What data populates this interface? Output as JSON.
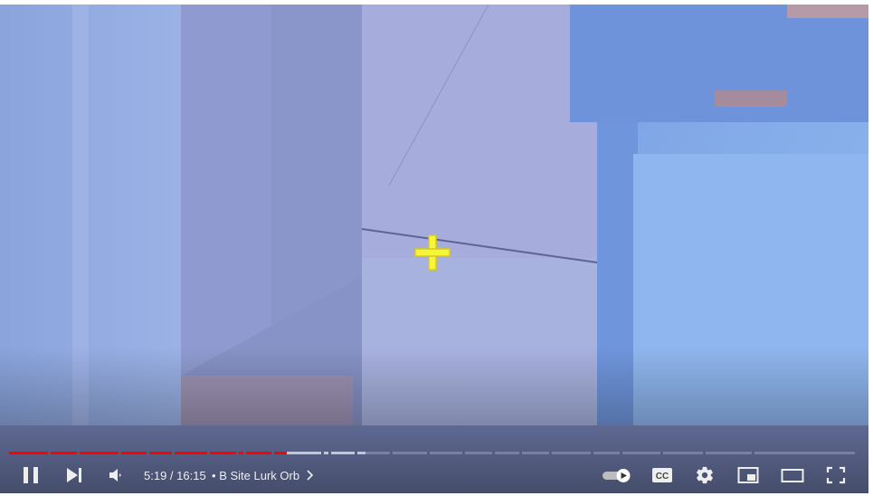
{
  "player": {
    "time": {
      "current": "5:19",
      "separator": " / ",
      "duration": "16:15"
    },
    "chapter": {
      "dot": "•",
      "title": "B Site Lurk Orb",
      "chevron_icon": "chevron-right-icon"
    },
    "progress": {
      "played_fraction": 0.327,
      "buffered_fraction": 0.42,
      "played_color": "#ff0000",
      "chapter_count": 23
    },
    "buttons": {
      "play_pause": {
        "icon": "pause-icon",
        "state": "playing"
      },
      "next": {
        "icon": "next-icon"
      },
      "volume": {
        "icon": "volume-muted-icon"
      },
      "autoplay": {
        "icon": "autoplay-toggle-icon",
        "on": true
      },
      "captions": {
        "icon": "captions-icon",
        "label": "CC"
      },
      "settings": {
        "icon": "gear-icon"
      },
      "miniplayer": {
        "icon": "miniplayer-icon"
      },
      "theater": {
        "icon": "theater-mode-icon"
      },
      "fullscreen": {
        "icon": "fullscreen-icon"
      }
    },
    "overlay": {
      "crosshair_icon": "crosshair-icon",
      "crosshair_color": "#f5f53a"
    }
  }
}
